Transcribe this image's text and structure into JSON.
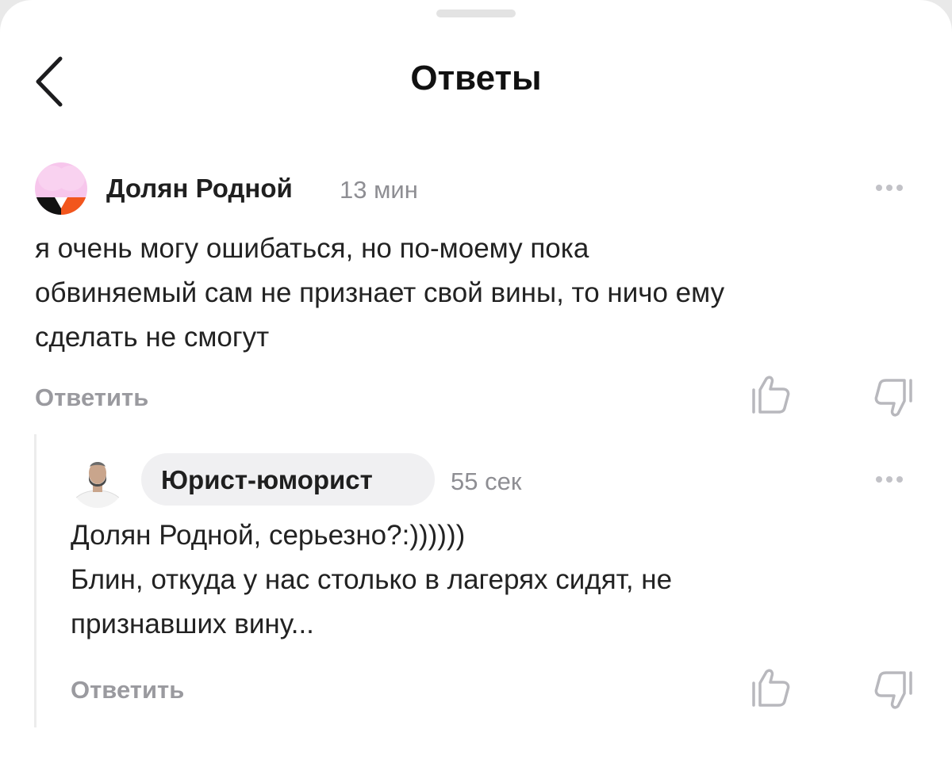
{
  "header": {
    "title": "Ответы",
    "back_icon": "chevron-left-icon"
  },
  "comments": [
    {
      "author": "Долян Родной",
      "time": "13 мин",
      "text": "я очень могу ошибаться, но по-моему пока\nобвиняемый сам не признает свой вины, то ничо ему\nсделать не смогут",
      "reply_label": "Ответить",
      "avatar_colors": {
        "top": "#f7c6ec",
        "left": "#111111",
        "right": "#f2561d"
      }
    },
    {
      "author": "Юрист-юморист",
      "time": "55 сек",
      "text": "Долян Родной, серьезно?:))))))\nБлин, откуда у нас столько в лагерях сидят, не\nпризнавших вину...",
      "reply_label": "Ответить"
    }
  ],
  "colors": {
    "meta_gray": "#8e8e93",
    "reply_gray": "#9a9a9f",
    "icon_gray": "#b8b8bd",
    "pill_bg": "#f0f0f2"
  },
  "icons": [
    "chevron-left-icon",
    "more-icon",
    "thumbs-up-icon",
    "thumbs-down-icon"
  ]
}
